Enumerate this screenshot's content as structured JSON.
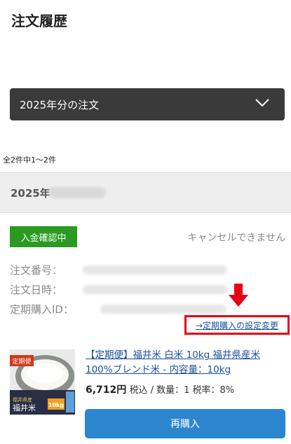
{
  "header": {
    "title": "注文履歴"
  },
  "year_filter": {
    "selected": "2025年分の注文",
    "icon": "chevron-down-icon"
  },
  "result_count": "全2件中1～2件",
  "order": {
    "date_prefix": "2025年",
    "status": "入金確認中",
    "cancel_note": "キャンセルできません",
    "order_number_label": "注文番号：",
    "order_date_label": "注文日時：",
    "subscription_id_label": "定期購入ID：",
    "subscription_link": "→定期購入の設定変更",
    "product": {
      "name": "【定期便】福井米 白米 10kg 福井県産米100%ブレンド米 - 内容量：10kg",
      "price": "6,712円",
      "price_detail": "税込 / 数量：1 税率：8%",
      "thumb_tag": "定期便",
      "thumb_origin": "福井県産",
      "thumb_brand": "福井米",
      "thumb_weight": "10kg"
    },
    "rebuy_label": "再購入"
  },
  "colors": {
    "status_green": "#2a9a22",
    "rebuy_blue": "#2b86cf",
    "highlight_red": "#e60012",
    "link_blue": "#1a4f9c"
  }
}
